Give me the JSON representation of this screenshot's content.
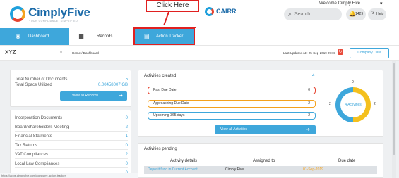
{
  "header": {
    "brand_name": "CimplyFive",
    "brand_tagline": "YOUR COMPLIANCE, SIMPLIFIED",
    "callout": "Click Here",
    "partner_logo": "CAIRR",
    "welcome": "Welcome Cimply  Five",
    "search_placeholder": "Search",
    "notification_count": "1429",
    "help_label": "Help"
  },
  "nav": {
    "tabs": [
      {
        "label": "Dashboard",
        "icon": "dashboard-icon",
        "active": true
      },
      {
        "label": "Records",
        "icon": "folder-icon",
        "active": false
      },
      {
        "label": "Action Tracker",
        "icon": "tracker-icon",
        "active": true
      }
    ]
  },
  "crumbs": {
    "company": "XYZ",
    "breadcrumb": "Home  /  Dashboard",
    "last_updated": "Last Updated At : 25-Sep-2019 09:01",
    "company_button": "Company Data"
  },
  "documents": {
    "total_label": "Total Number of Documents",
    "total_value": "5",
    "space_label": "Total Space Utilized",
    "space_value": "0.00458007 GB",
    "view_button": "View all Records"
  },
  "categories": [
    {
      "label": "Incorporation Documents",
      "value": "0"
    },
    {
      "label": "Board/Shareholders Meeting",
      "value": "2"
    },
    {
      "label": "Financial Statments",
      "value": "1"
    },
    {
      "label": "Tax Returns",
      "value": "0"
    },
    {
      "label": "VAT Compliances",
      "value": "2"
    },
    {
      "label": "Local Law Compliances",
      "value": "0"
    },
    {
      "label": "",
      "value": "0"
    }
  ],
  "status_url": "https://apps.cimplyfive.com/company-action-tracker",
  "activities": {
    "title": "Activities created",
    "count": "4",
    "rows": [
      {
        "label": "Past Due Date",
        "value": "0"
      },
      {
        "label": "Approaching Due Date",
        "value": "2"
      },
      {
        "label": "Upcoming-365 days",
        "value": "2"
      }
    ],
    "view_button": "View all Activities",
    "donut": {
      "center_label": "4 Activities",
      "top": "0",
      "left": "2",
      "right": "2",
      "colors": {
        "approaching": "#f4c01e",
        "upcoming": "#3ea7db"
      }
    }
  },
  "pending": {
    "title": "Activities pending",
    "columns": [
      "Activity details",
      "Assigned to",
      "Due date"
    ],
    "rows": [
      {
        "detail": "Deposit fund in Current Account",
        "assigned": "Cimply Five",
        "due": "01-Sep-2019"
      }
    ]
  },
  "colors": {
    "primary": "#3ea7db",
    "danger": "#e6432f",
    "warning": "#f4a21e",
    "brand": "#1a6aa8"
  }
}
